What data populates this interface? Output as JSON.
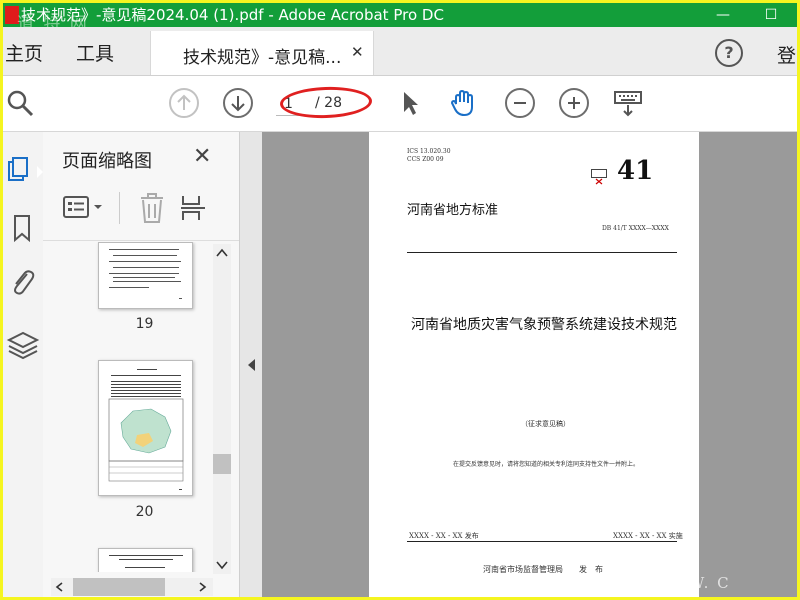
{
  "window": {
    "title": "技术规范》-意见稿2024.04 (1).pdf - Adobe Acrobat Pro DC",
    "watermark": "道 特 网",
    "minimize": "—",
    "maximize": "☐",
    "colors": {
      "titlebar": "#139e3a",
      "border": "#f5f520"
    }
  },
  "tabbar": {
    "home": "主页",
    "tools": "工具",
    "doc_tab_label": "技术规范》-意见稿...",
    "doc_tab_close": "✕",
    "help": "?",
    "signin": "登"
  },
  "toolbar": {
    "current_page": "1",
    "total_pages": "/ 28",
    "icons": [
      "search-zoom-icon",
      "prev-page-icon",
      "next-page-icon",
      "select-cursor-icon",
      "hand-tool-icon",
      "zoom-out-icon",
      "zoom-in-icon",
      "keyboard-icon"
    ]
  },
  "sidebar": {
    "title": "页面缩略图",
    "close": "✕",
    "thumbnails": [
      {
        "page": "19"
      },
      {
        "page": "20"
      }
    ]
  },
  "document": {
    "ics": "ICS 13.020.30",
    "ccs": "CCS Z00 09",
    "code": "41",
    "standard_type": "河南省地方标准",
    "db_number": "DB 41/T XXXX—XXXX",
    "title": "河南省地质灾害气象预警系统建设技术规范",
    "draft_note": "（征求意见稿）",
    "instruction": "在提交反馈意见时，请将您知道的相关专利连同支持性文件一并附上。",
    "publish_date": "XXXX - XX - XX 发布",
    "implement_date": "XXXX - XX - XX 实施",
    "publisher": "河南省市场监督管理局　　发　布",
    "watermark": "WWW. C"
  }
}
